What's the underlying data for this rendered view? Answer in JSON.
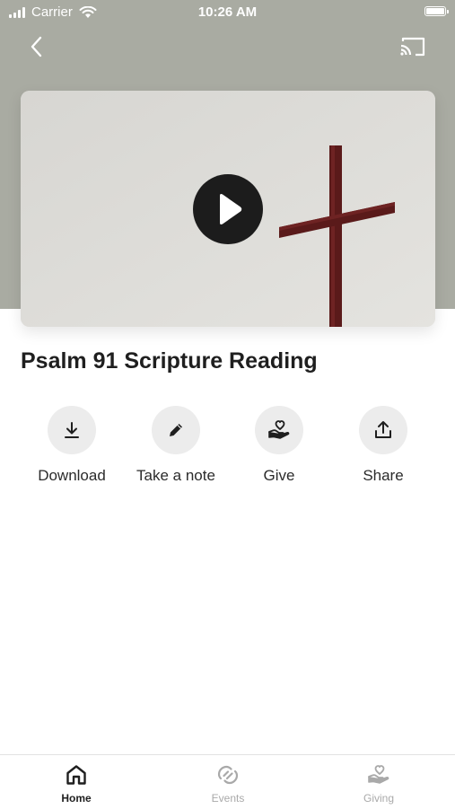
{
  "status_bar": {
    "carrier": "Carrier",
    "time": "10:26 AM"
  },
  "header": {
    "background_color": "#a9aba2",
    "back_icon": "chevron-left-icon",
    "cast_icon": "cast-icon"
  },
  "video": {
    "play_icon": "play-icon",
    "title": "Psalm 91 Scripture Reading"
  },
  "actions": [
    {
      "label": "Download",
      "icon": "download-icon"
    },
    {
      "label": "Take a note",
      "icon": "pencil-icon"
    },
    {
      "label": "Give",
      "icon": "heart-hand-icon"
    },
    {
      "label": "Share",
      "icon": "share-icon"
    }
  ],
  "tab_bar": {
    "tabs": [
      {
        "label": "Home",
        "icon": "home-icon",
        "active": true
      },
      {
        "label": "Events",
        "icon": "events-icon",
        "active": false
      },
      {
        "label": "Giving",
        "icon": "heart-hand-icon",
        "active": false
      }
    ],
    "active_color": "#1f1f1f",
    "inactive_color": "#a9a9a9"
  }
}
